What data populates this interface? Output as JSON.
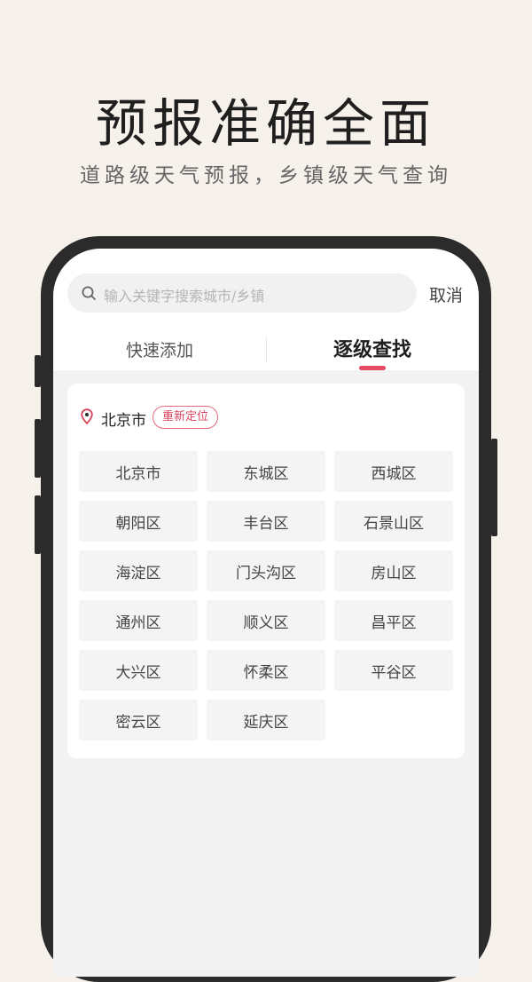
{
  "promo": {
    "headline": "预报准确全面",
    "subline": "道路级天气预报，乡镇级天气查询"
  },
  "search": {
    "placeholder": "输入关键字搜索城市/乡镇",
    "cancel_label": "取消"
  },
  "tabs": [
    {
      "label": "快速添加",
      "active": false
    },
    {
      "label": "逐级查找",
      "active": true
    }
  ],
  "location": {
    "current_city": "北京市",
    "relocate_label": "重新定位"
  },
  "districts": [
    "北京市",
    "东城区",
    "西城区",
    "朝阳区",
    "丰台区",
    "石景山区",
    "海淀区",
    "门头沟区",
    "房山区",
    "通州区",
    "顺义区",
    "昌平区",
    "大兴区",
    "怀柔区",
    "平谷区",
    "密云区",
    "延庆区"
  ],
  "colors": {
    "accent": "#e64b63",
    "background": "#f6f1ea",
    "phone_frame": "#2b2b2b"
  }
}
